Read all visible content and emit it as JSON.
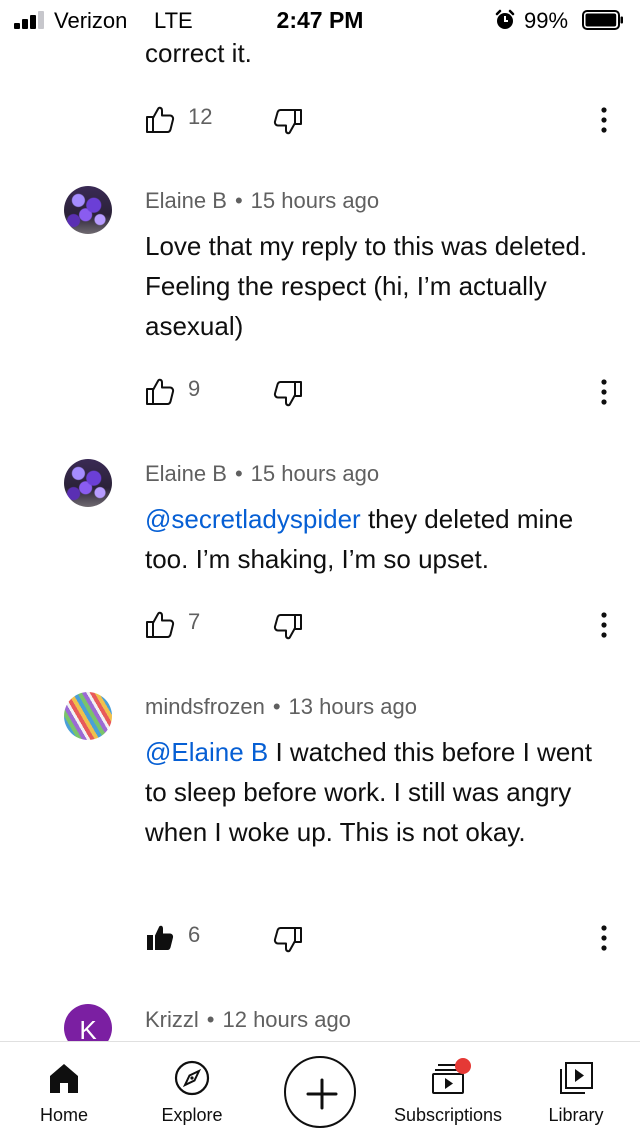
{
  "status": {
    "carrier": "Verizon",
    "network": "LTE",
    "time": "2:47 PM",
    "battery": "99%",
    "battery_level": 0.99
  },
  "partial_comment": {
    "text": "correct it.",
    "likes": "12"
  },
  "comments": [
    {
      "author": "Elaine B",
      "separator": "•",
      "time": "15 hours ago",
      "mention": "",
      "text": "Love that my reply to this was deleted. Feeling the respect (hi, I’m actually asexual)",
      "likes": "9",
      "liked": false
    },
    {
      "author": "Elaine B",
      "separator": "•",
      "time": "15 hours ago",
      "mention": "@secretladyspider",
      "text": " they deleted mine too. I’m shaking, I’m so upset.",
      "likes": "7",
      "liked": false
    },
    {
      "author": "mindsfrozen",
      "separator": "•",
      "time": "13 hours ago",
      "mention": "@Elaine B",
      "text": " I watched this before I went to sleep before work. I still was angry when I woke up. This is not okay.",
      "likes": "6",
      "liked": true
    },
    {
      "author": "Krizzl",
      "separator": "•",
      "time": "12 hours ago",
      "avatar_letter": "K"
    }
  ],
  "nav": {
    "home": "Home",
    "explore": "Explore",
    "subscriptions": "Subscriptions",
    "library": "Library"
  },
  "icons": {
    "like": "thumbs-up-outline-icon",
    "like_filled": "thumbs-up-filled-icon",
    "dislike": "thumbs-down-outline-icon",
    "more": "more-vertical-icon",
    "home": "home-icon",
    "explore": "compass-icon",
    "create": "plus-icon",
    "subscriptions": "subscriptions-icon",
    "library": "library-icon"
  },
  "colors": {
    "mention": "#065fd4",
    "meta": "#606060",
    "text": "#0f0f0f",
    "notification": "#e53935",
    "krizzl_avatar": "#7b1fa2"
  }
}
